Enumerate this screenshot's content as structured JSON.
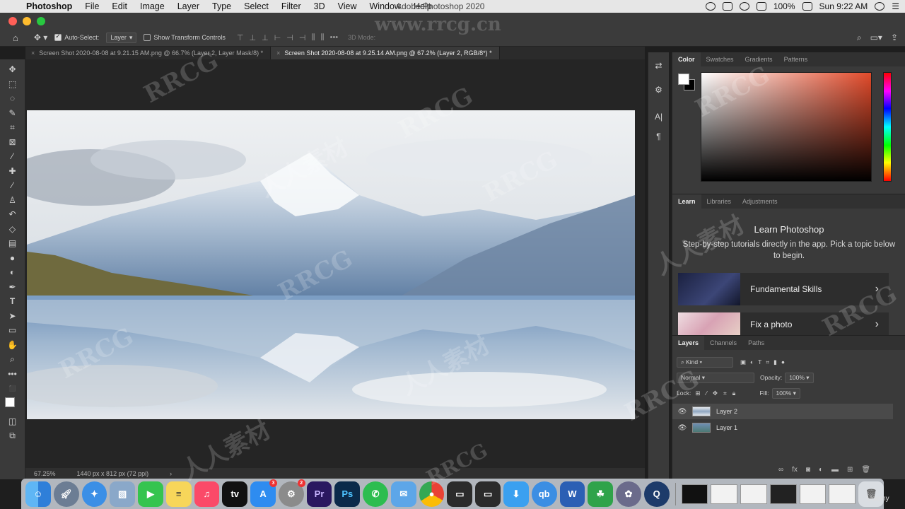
{
  "menubar": {
    "app_name": "Photoshop",
    "items": [
      "File",
      "Edit",
      "Image",
      "Layer",
      "Type",
      "Select",
      "Filter",
      "3D",
      "View",
      "Window",
      "Help"
    ],
    "window_title": "Adobe Photoshop 2020",
    "battery": "100%",
    "clock": "Sun 9:22 AM"
  },
  "options": {
    "auto_select_label": "Auto-Select:",
    "auto_select_value": "Layer",
    "transform_label": "Show Transform Controls",
    "mode_3d_label": "3D Mode:"
  },
  "tabs": [
    {
      "label": "Screen Shot 2020-08-08 at 9.21.15 AM.png @ 66.7% (Layer 2, Layer Mask/8) *"
    },
    {
      "label": "Screen Shot 2020-08-08 at 9.25.14 AM.png @ 67.2% (Layer 2, RGB/8*) *"
    }
  ],
  "status": {
    "zoom": "67.25%",
    "doc_info": "1440 px x 812 px (72 ppi)"
  },
  "color_panel": {
    "tabs": [
      "Color",
      "Swatches",
      "Gradients",
      "Patterns"
    ],
    "foreground": "#ffffff",
    "background": "#000000",
    "hue_color": "#e24a2a"
  },
  "learn_panel": {
    "tabs": [
      "Learn",
      "Libraries",
      "Adjustments"
    ],
    "title": "Learn Photoshop",
    "description": "Step-by-step tutorials directly in the app. Pick a topic below to begin.",
    "cards": [
      "Fundamental Skills",
      "Fix a photo"
    ]
  },
  "layers_panel": {
    "tabs": [
      "Layers",
      "Channels",
      "Paths"
    ],
    "filter_kind": "Kind",
    "blend_mode": "Normal",
    "opacity_label": "Opacity:",
    "opacity_value": "100%",
    "lock_label": "Lock:",
    "fill_label": "Fill:",
    "fill_value": "100%",
    "layers": [
      {
        "name": "Layer 2",
        "selected": true
      },
      {
        "name": "Layer 1",
        "selected": false
      }
    ],
    "footer_fx": "fx"
  },
  "dock": {
    "apps": [
      "Finder",
      "Launchpad",
      "Safari",
      "Preview",
      "FaceTime",
      "Notes",
      "Music",
      "TV",
      "App Store",
      "System Preferences",
      "Premiere Pro",
      "Photoshop",
      "WhatsApp",
      "Mail",
      "Chrome",
      "Screen",
      "Screen",
      "Downloader",
      "qBittorrent",
      "Word",
      "Camera",
      "Photo",
      "QuickTime"
    ],
    "app_store_badge": "3",
    "sysprefs_badge": "2",
    "app_labels": {
      "tv": "tv",
      "premiere": "Pr",
      "photoshop": "Ps",
      "qb": "qb",
      "word": "W"
    }
  },
  "watermarks": [
    "RRCG",
    "人人素材",
    "www.rrcg.cn"
  ],
  "overlay_label": "Udemy"
}
